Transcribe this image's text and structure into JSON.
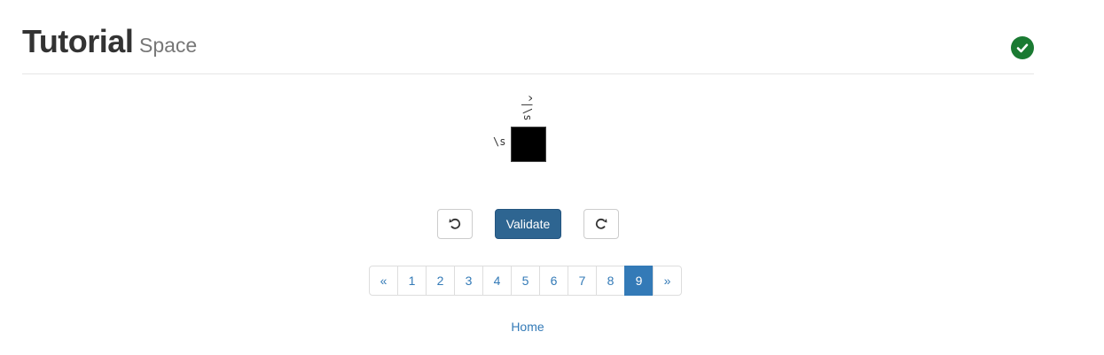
{
  "header": {
    "title": "Tutorial",
    "subtitle": "Space",
    "status_icon": "check-circle-icon",
    "status_color": "#1a7a32"
  },
  "puzzle": {
    "column_hint": "\\s",
    "row_hint": "\\s",
    "column_hint_visual": "^|\\s",
    "cell_filled": true
  },
  "controls": {
    "undo_icon": "undo-icon",
    "validate_label": "Validate",
    "redo_icon": "redo-icon",
    "accent": "#2e6591"
  },
  "pagination": {
    "prev": "«",
    "pages": [
      "1",
      "2",
      "3",
      "4",
      "5",
      "6",
      "7",
      "8",
      "9"
    ],
    "current": "9",
    "next": "»"
  },
  "footer": {
    "home_label": "Home"
  }
}
